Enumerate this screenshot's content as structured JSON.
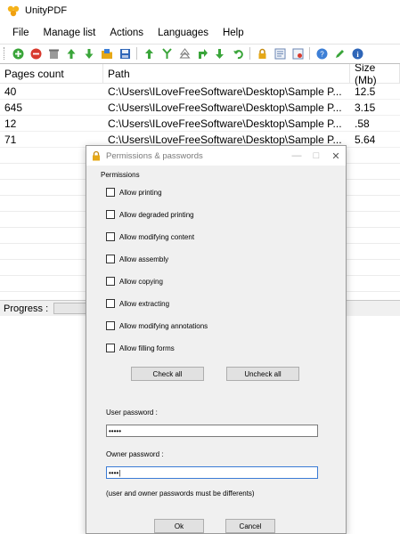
{
  "app": {
    "title": "UnityPDF",
    "menu": [
      "File",
      "Manage list",
      "Actions",
      "Languages",
      "Help"
    ]
  },
  "toolbar": {
    "icons": [
      "add-icon",
      "remove-icon",
      "clear-icon",
      "move-up-icon",
      "move-down-icon",
      "open-icon",
      "save-list-icon",
      "merge-icon",
      "split-icon",
      "tree-icon",
      "rotate-icon",
      "extract-icon",
      "undo-icon",
      "lock-icon",
      "properties-icon",
      "settings-icon",
      "help-icon",
      "edit-icon",
      "info-icon"
    ]
  },
  "grid": {
    "headers": [
      "Pages count",
      "Path",
      "Size (Mb)"
    ],
    "rows": [
      {
        "pages": "40",
        "path": "C:\\Users\\ILoveFreeSoftware\\Desktop\\Sample P...",
        "size": "12.5"
      },
      {
        "pages": "645",
        "path": "C:\\Users\\ILoveFreeSoftware\\Desktop\\Sample P...",
        "size": "3.15"
      },
      {
        "pages": "12",
        "path": "C:\\Users\\ILoveFreeSoftware\\Desktop\\Sample P...",
        "size": ".58"
      },
      {
        "pages": "71",
        "path": "C:\\Users\\ILoveFreeSoftware\\Desktop\\Sample P...",
        "size": "5.64"
      }
    ]
  },
  "progress": {
    "label": "Progress :",
    "value": 0
  },
  "dialog": {
    "title": "Permissions & passwords",
    "permissions_heading": "Permissions",
    "options": [
      {
        "label": "Allow printing",
        "checked": false
      },
      {
        "label": "Allow degraded printing",
        "checked": false
      },
      {
        "label": "Allow modifying content",
        "checked": false
      },
      {
        "label": "Allow assembly",
        "checked": false
      },
      {
        "label": "Allow copying",
        "checked": false
      },
      {
        "label": "Allow extracting",
        "checked": false
      },
      {
        "label": "Allow modifying annotations",
        "checked": false
      },
      {
        "label": "Allow filling forms",
        "checked": false
      }
    ],
    "check_all": "Check all",
    "uncheck_all": "Uncheck all",
    "user_password_label": "User password :",
    "user_password_value": "•••••",
    "owner_password_label": "Owner password :",
    "owner_password_value": "••••|",
    "note": "(user and owner passwords must be differents)",
    "ok": "Ok",
    "cancel": "Cancel"
  }
}
